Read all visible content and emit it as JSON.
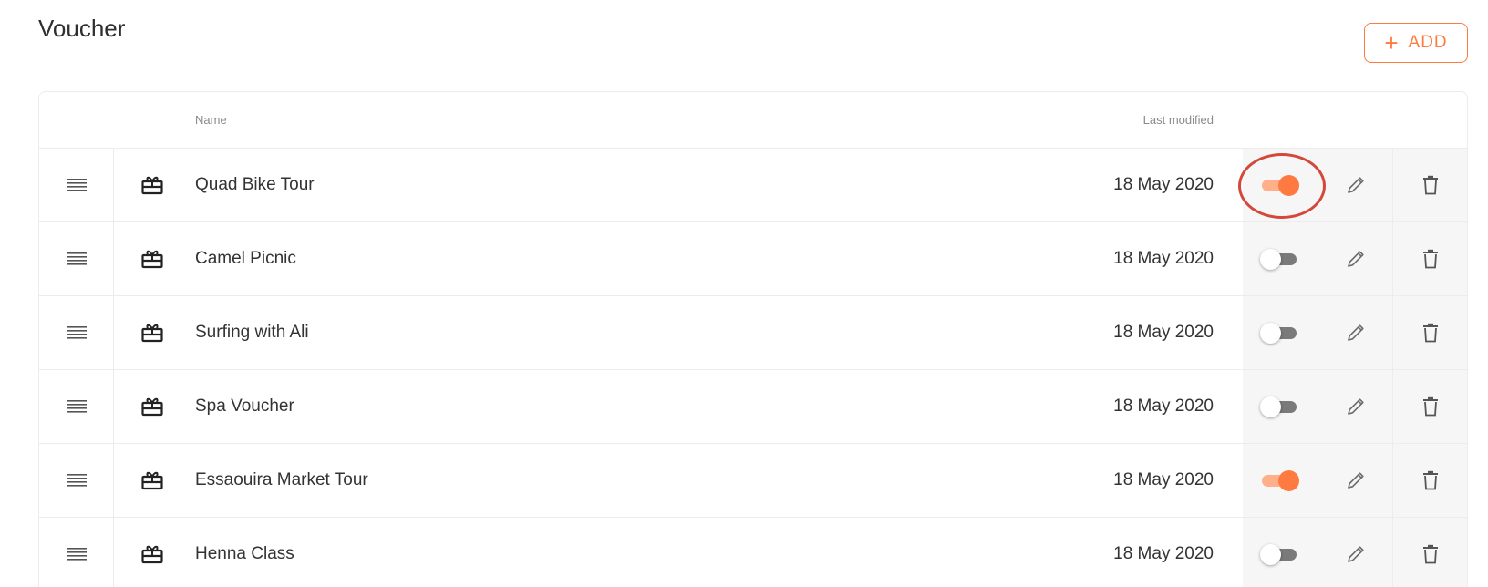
{
  "header": {
    "title": "Voucher",
    "add_label": "ADD",
    "add_icon": "+"
  },
  "table": {
    "columns": {
      "name": "Name",
      "last_modified": "Last modified"
    },
    "rows": [
      {
        "name": "Quad Bike Tour",
        "last_modified": "18 May 2020",
        "enabled": true
      },
      {
        "name": "Camel Picnic",
        "last_modified": "18 May 2020",
        "enabled": false
      },
      {
        "name": "Surfing with Ali",
        "last_modified": "18 May 2020",
        "enabled": false
      },
      {
        "name": "Spa Voucher",
        "last_modified": "18 May 2020",
        "enabled": false
      },
      {
        "name": "Essaouira Market Tour",
        "last_modified": "18 May 2020",
        "enabled": true
      },
      {
        "name": "Henna Class",
        "last_modified": "18 May 2020",
        "enabled": false
      }
    ]
  },
  "icons": {
    "drag": "drag-handle-icon",
    "type": "gift-card-icon",
    "edit": "pencil-icon",
    "delete": "trash-icon"
  },
  "colors": {
    "accent": "#ff7a40",
    "toggle_on_track": "#ffb08a",
    "toggle_off_track": "#7a7a7a",
    "highlight_ring": "#d4483b"
  }
}
